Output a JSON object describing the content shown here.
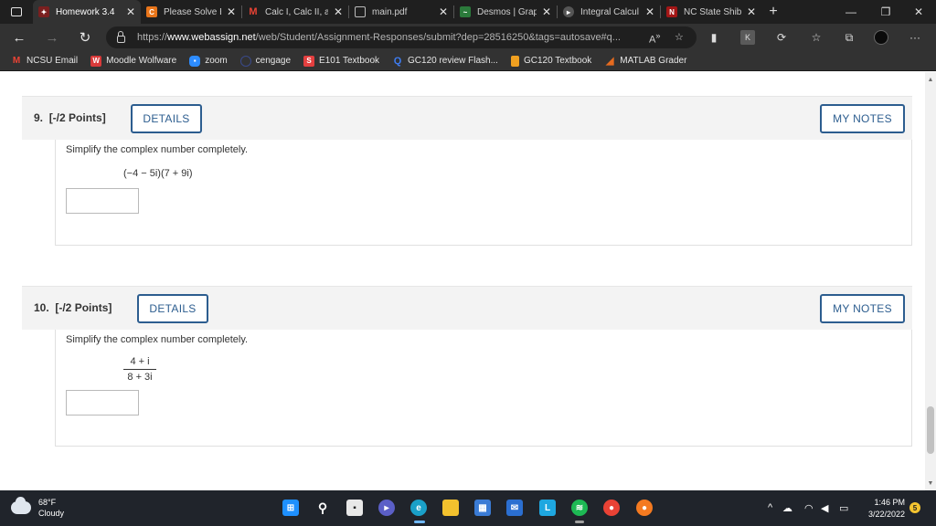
{
  "browser": {
    "tabs": [
      {
        "title": "Homework 3.4",
        "active": true
      },
      {
        "title": "Please Solve Bo",
        "active": false
      },
      {
        "title": "Calc I, Calc II, a",
        "active": false
      },
      {
        "title": "main.pdf",
        "active": false
      },
      {
        "title": "Desmos | Grap",
        "active": false
      },
      {
        "title": "Integral Calcul",
        "active": false
      },
      {
        "title": "NC State Shibb",
        "active": false
      }
    ],
    "new_tab": "+",
    "controls": {
      "minimize": "—",
      "restore": "❐",
      "close": "✕"
    },
    "url": {
      "scheme": "https://",
      "host": "www.webassign.net",
      "path": "/web/Student/Assignment-Responses/submit?dep=28516250&tags=autosave#q..."
    },
    "toolbar_icons": [
      "read-aloud-icon",
      "favorite-add-icon",
      "extension-icon",
      "collections-icon",
      "refresh-icon",
      "favorites-icon",
      "sync-icon",
      "profile-icon",
      "menu-icon"
    ]
  },
  "bookmarks": [
    {
      "label": "NCSU Email",
      "color": "#c5221f",
      "glyph": "M"
    },
    {
      "label": "Moodle Wolfware",
      "color": "#d93a3a",
      "glyph": "W"
    },
    {
      "label": "zoom",
      "color": "#2d8cff",
      "glyph": "z"
    },
    {
      "label": "cengage",
      "color": "#3b3b3b",
      "glyph": "c"
    },
    {
      "label": "E101 Textbook",
      "color": "#e43f3f",
      "glyph": "E"
    },
    {
      "label": "GC120 review Flash...",
      "color": "#2f6fde",
      "glyph": "Q"
    },
    {
      "label": "GC120 Textbook",
      "color": "#f0a020",
      "glyph": "B"
    },
    {
      "label": "MATLAB Grader",
      "color": "#e66b1f",
      "glyph": "M"
    }
  ],
  "questions": [
    {
      "number": "9.",
      "points": "[-/2 Points]",
      "details_label": "DETAILS",
      "notes_label": "MY NOTES",
      "prompt": "Simplify the complex number completely.",
      "expression": "(−4 − 5i)(7 + 9i)"
    },
    {
      "number": "10.",
      "points": "[-/2 Points]",
      "details_label": "DETAILS",
      "notes_label": "MY NOTES",
      "prompt": "Simplify the complex number completely.",
      "numerator": "4 + i",
      "denominator": "8 + 3i"
    }
  ],
  "taskbar": {
    "weather_temp": "68°F",
    "weather_desc": "Cloudy",
    "time": "1:46 PM",
    "date": "3/22/2022",
    "notifications": "5"
  }
}
